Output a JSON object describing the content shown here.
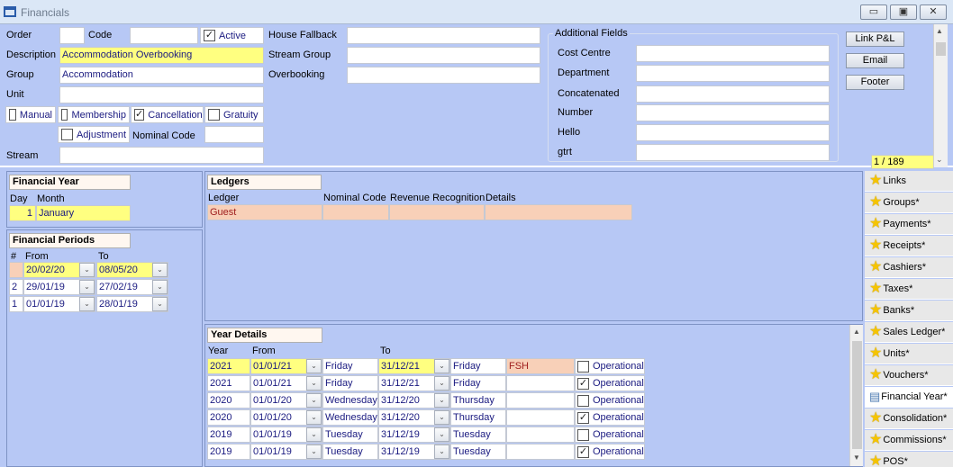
{
  "window": {
    "title": "Financials",
    "min": "▭",
    "max": "▣",
    "close": "✕"
  },
  "form": {
    "order_label": "Order",
    "code_label": "Code",
    "active_label": "Active",
    "active_checked": true,
    "house_fallback_label": "House Fallback",
    "description_label": "Description",
    "description_value": "Accommodation Overbooking",
    "stream_group_label": "Stream Group",
    "group_label": "Group",
    "group_value": "Accommodation",
    "overbooking_label": "Overbooking",
    "unit_label": "Unit",
    "manual_label": "Manual",
    "membership_label": "Membership",
    "cancellation_label": "Cancellation",
    "gratuity_label": "Gratuity",
    "adjustment_label": "Adjustment",
    "nominal_code_label": "Nominal Code",
    "stream_label": "Stream",
    "manual_checked": false,
    "membership_checked": false,
    "cancellation_checked": true,
    "gratuity_checked": false,
    "adjustment_checked": false
  },
  "additional": {
    "title": "Additional Fields",
    "fields": [
      "Cost Centre",
      "Department",
      "Concatenated",
      "Number",
      "Hello",
      "gtrt"
    ]
  },
  "buttons": {
    "link_pl": "Link P&L",
    "email": "Email",
    "footer": "Footer"
  },
  "record_counter": "1 / 189",
  "financial_year": {
    "title": "Financial Year",
    "day_label": "Day",
    "month_label": "Month",
    "day": "1",
    "month": "January"
  },
  "financial_periods": {
    "title": "Financial Periods",
    "col_num": "#",
    "col_from": "From",
    "col_to": "To",
    "rows": [
      {
        "n": "",
        "from": "20/02/20",
        "to": "08/05/20",
        "hl": true
      },
      {
        "n": "2",
        "from": "29/01/19",
        "to": "27/02/19",
        "hl": false
      },
      {
        "n": "1",
        "from": "01/01/19",
        "to": "28/01/19",
        "hl": false
      }
    ]
  },
  "ledgers": {
    "title": "Ledgers",
    "cols": [
      "Ledger",
      "Nominal Code",
      "Revenue Recognition",
      "Details"
    ],
    "rows": [
      [
        "Guest",
        "",
        "",
        ""
      ]
    ]
  },
  "year_details": {
    "title": "Year Details",
    "col_year": "Year",
    "col_from": "From",
    "col_to": "To",
    "rows": [
      {
        "year": "2021",
        "from": "01/01/21",
        "from_day": "Friday",
        "to": "31/12/21",
        "to_day": "Friday",
        "code": "FSH",
        "op": false,
        "label": "Operational",
        "hl": true
      },
      {
        "year": "2021",
        "from": "01/01/21",
        "from_day": "Friday",
        "to": "31/12/21",
        "to_day": "Friday",
        "code": "",
        "op": true,
        "label": "Operational",
        "hl": false
      },
      {
        "year": "2020",
        "from": "01/01/20",
        "from_day": "Wednesday",
        "to": "31/12/20",
        "to_day": "Thursday",
        "code": "",
        "op": false,
        "label": "Operational",
        "hl": false
      },
      {
        "year": "2020",
        "from": "01/01/20",
        "from_day": "Wednesday",
        "to": "31/12/20",
        "to_day": "Thursday",
        "code": "",
        "op": true,
        "label": "Operational",
        "hl": false
      },
      {
        "year": "2019",
        "from": "01/01/19",
        "from_day": "Tuesday",
        "to": "31/12/19",
        "to_day": "Tuesday",
        "code": "",
        "op": false,
        "label": "Operational",
        "hl": false
      },
      {
        "year": "2019",
        "from": "01/01/19",
        "from_day": "Tuesday",
        "to": "31/12/19",
        "to_day": "Tuesday",
        "code": "",
        "op": true,
        "label": "Operational",
        "hl": false
      }
    ]
  },
  "tabs": [
    "Links",
    "Groups*",
    "Payments*",
    "Receipts*",
    "Cashiers*",
    "Taxes*",
    "Banks*",
    "Sales Ledger*",
    "Units*",
    "Vouchers*",
    "Financial Year*",
    "Consolidation*",
    "Commissions*",
    "POS*"
  ],
  "selected_tab": 10
}
